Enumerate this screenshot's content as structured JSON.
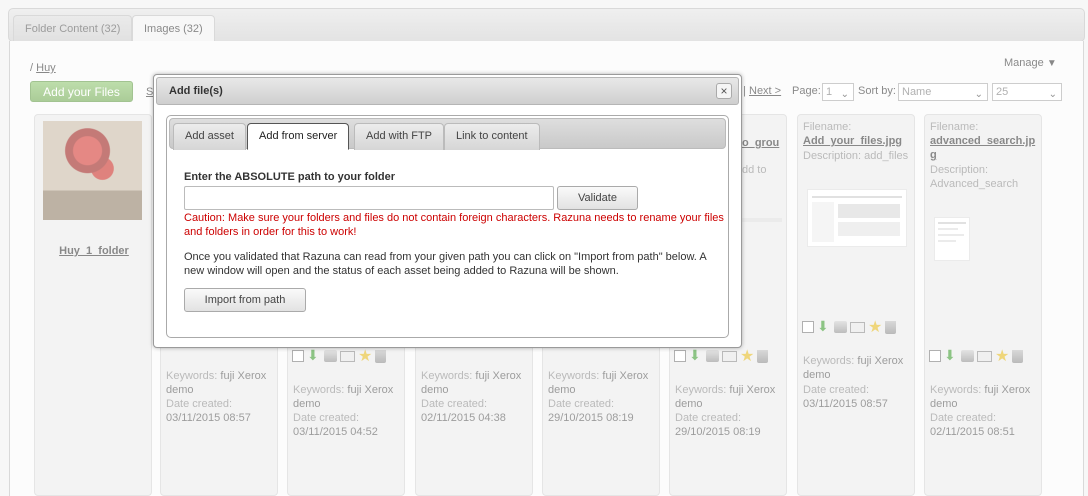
{
  "tabs": [
    {
      "label": "Folder Content (32)"
    },
    {
      "label": "Images (32)"
    }
  ],
  "breadcrumb": {
    "separator": "/",
    "folder": "Huy"
  },
  "manage_label": "Manage",
  "add_files_label": "Add your Files",
  "pager": {
    "partial_link": "S",
    "separator": "|",
    "next_label": "Next >",
    "page_label": "Page:",
    "page_value": "1",
    "sort_label": "Sort by:",
    "sort_value": "Name",
    "per_page_value": "25"
  },
  "folder_card": {
    "name": "Huy_1_folder"
  },
  "cards": [
    {
      "keywords_label": "Keywords:",
      "keywords": "fuji Xerox demo",
      "date_label": "Date created:",
      "date": "03/11/2015 08:57"
    },
    {
      "keywords_label": "Keywords:",
      "keywords": "fuji Xerox demo",
      "date_label": "Date created:",
      "date": "03/11/2015 04:52"
    },
    {
      "keywords_label": "Keywords:",
      "keywords": "fuji Xerox demo",
      "date_label": "Date created:",
      "date": "02/11/2015 04:38"
    },
    {
      "keywords_label": "Keywords:",
      "keywords": "fuji Xerox demo",
      "date_label": "Date created:",
      "date": "29/10/2015 08:19"
    },
    {
      "partial_name": "o_grou",
      "partial_desc": "dd to",
      "keywords_label": "Keywords:",
      "keywords": "fuji Xerox demo",
      "date_label": "Date created:",
      "date": "29/10/2015 08:19"
    },
    {
      "filename_label": "Filename:",
      "filename": "Add_your_files.jpg",
      "desc_label": "Description:",
      "desc": "add_files",
      "keywords_label": "Keywords:",
      "keywords": "fuji Xerox demo",
      "date_label": "Date created:",
      "date": "03/11/2015 08:57"
    },
    {
      "filename_label": "Filename:",
      "filename": "advanced_search.jpg",
      "desc_label": "Description:",
      "desc": "Advanced_search",
      "keywords_label": "Keywords:",
      "keywords": "fuji Xerox demo",
      "date_label": "Date created:",
      "date": "02/11/2015 08:51"
    }
  ],
  "modal": {
    "title": "Add file(s)",
    "close": "×",
    "tabs": [
      "Add asset",
      "Add from server",
      "Add with FTP",
      "Link to content"
    ],
    "path_label": "Enter the ABSOLUTE path to your folder",
    "path_value": "",
    "validate_label": "Validate",
    "caution": "Caution: Make sure your folders and files do not contain foreign characters. Razuna needs to rename your files and folders in order for this to work!",
    "info": "Once you validated that Razuna can read from your given path you can click on \"Import from path\" below. A new window will open and the status of each asset being added to Razuna will be shown.",
    "import_label": "Import from path"
  }
}
